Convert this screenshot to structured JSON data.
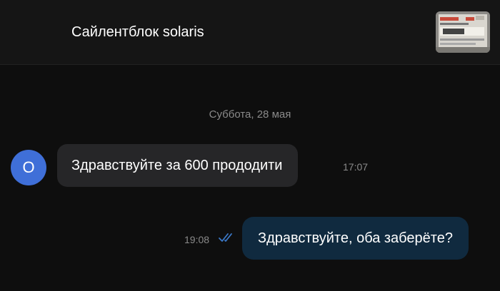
{
  "header": {
    "title": "Сайлентблок solaris",
    "thumbnail_icon": "product-photo-thumbnail"
  },
  "chat": {
    "date_separator": "Суббота, 28 мая",
    "messages": [
      {
        "direction": "incoming",
        "avatar_letter": "О",
        "text": "Здравствуйте за 600 прододити",
        "time": "17:07"
      },
      {
        "direction": "outgoing",
        "text": "Здравствуйте, оба заберёте?",
        "time": "19:08",
        "status_icon": "double-check-icon"
      }
    ]
  },
  "colors": {
    "background": "#0e0e0e",
    "header": "#151515",
    "incoming_bubble": "#262628",
    "outgoing_bubble": "#102a3f",
    "avatar": "#3f6fd8",
    "read_check": "#3b78c7",
    "muted_text": "#8a8a8a"
  }
}
